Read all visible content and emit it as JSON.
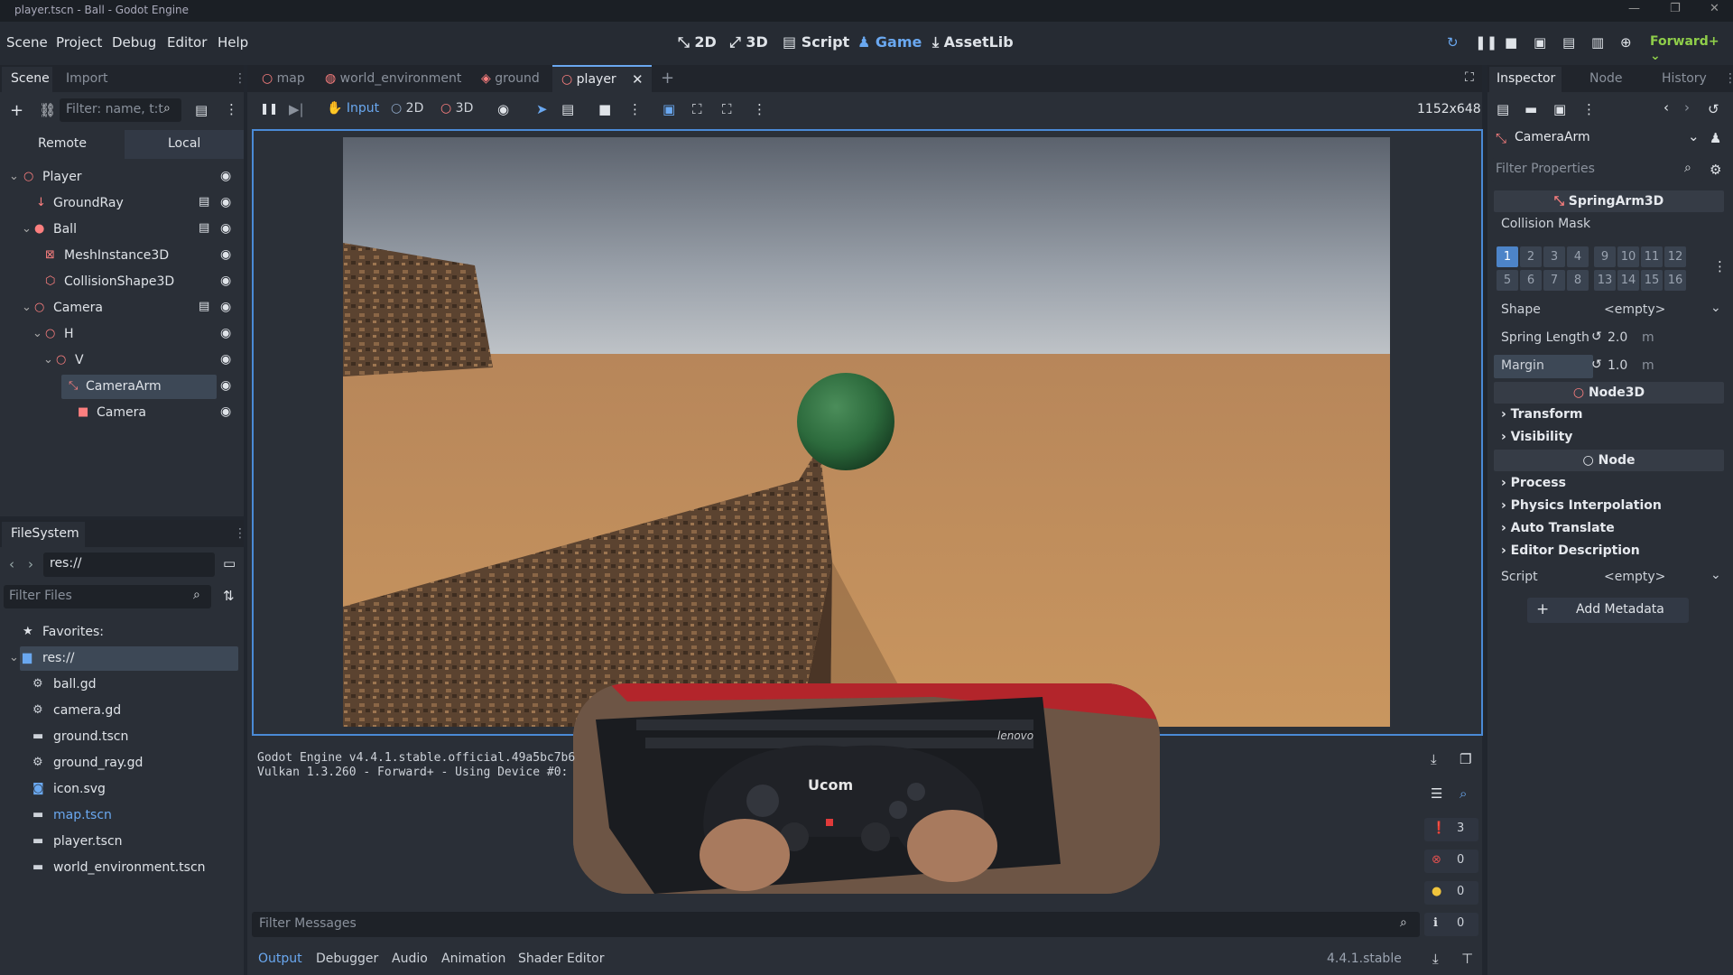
{
  "window": {
    "title": "player.tscn - Ball - Godot Engine"
  },
  "menu": [
    "Scene",
    "Project",
    "Debug",
    "Editor",
    "Help"
  ],
  "workspaces": {
    "d2": "2D",
    "d3": "3D",
    "script": "Script",
    "game": "Game",
    "assetlib": "AssetLib"
  },
  "renderer": "Forward+",
  "scene_dock": {
    "tabs": {
      "scene": "Scene",
      "import": "Import"
    },
    "filter_placeholder": "Filter: name, t:t",
    "remote": "Remote",
    "local": "Local",
    "tree": [
      "Player",
      "GroundRay",
      "Ball",
      "MeshInstance3D",
      "CollisionShape3D",
      "Camera",
      "H",
      "V",
      "CameraArm",
      "Camera"
    ]
  },
  "filesystem": {
    "title": "FileSystem",
    "path": "res://",
    "filter_placeholder": "Filter Files",
    "favorites": "Favorites:",
    "root": "res://",
    "files": [
      "ball.gd",
      "camera.gd",
      "ground.tscn",
      "ground_ray.gd",
      "icon.svg",
      "map.tscn",
      "player.tscn",
      "world_environment.tscn"
    ]
  },
  "scene_tabs": [
    "map",
    "world_environment",
    "ground",
    "player"
  ],
  "game_toolbar": {
    "input": "Input",
    "d2": "2D",
    "d3": "3D",
    "resolution": "1152x648"
  },
  "output": {
    "lines": [
      "Godot Engine v4.4.1.stable.official.49a5bc7b6",
      "Vulkan 1.3.260 - Forward+ - Using Device #0:"
    ],
    "filter_placeholder": "Filter Messages",
    "counts": {
      "messages": "3",
      "errors": "0",
      "warnings": "0",
      "info": "0"
    }
  },
  "bottom_tabs": [
    "Output",
    "Debugger",
    "Audio",
    "Animation",
    "Shader Editor"
  ],
  "version": "4.4.1.stable",
  "inspector": {
    "tabs": {
      "inspector": "Inspector",
      "node": "Node",
      "history": "History"
    },
    "object": "CameraArm",
    "filter_placeholder": "Filter Properties",
    "class_springarm": "SpringArm3D",
    "collision_mask_label": "Collision Mask",
    "bits_top": [
      "1",
      "2",
      "3",
      "4",
      "9",
      "10",
      "11",
      "12"
    ],
    "bits_bottom": [
      "5",
      "6",
      "7",
      "8",
      "13",
      "14",
      "15",
      "16"
    ],
    "shape_label": "Shape",
    "shape_value": "<empty>",
    "spring_length_label": "Spring Length",
    "spring_length_value": "2.0",
    "margin_label": "Margin",
    "margin_value": "1.0",
    "unit": "m",
    "class_node3d": "Node3D",
    "groups_node3d": [
      "Transform",
      "Visibility"
    ],
    "class_node": "Node",
    "groups_node": [
      "Process",
      "Physics Interpolation",
      "Auto Translate",
      "Editor Description"
    ],
    "script_label": "Script",
    "script_value": "<empty>",
    "add_metadata": "Add Metadata"
  },
  "keyboard_brand": "lenovo",
  "gamepad_brand": "Ucom"
}
